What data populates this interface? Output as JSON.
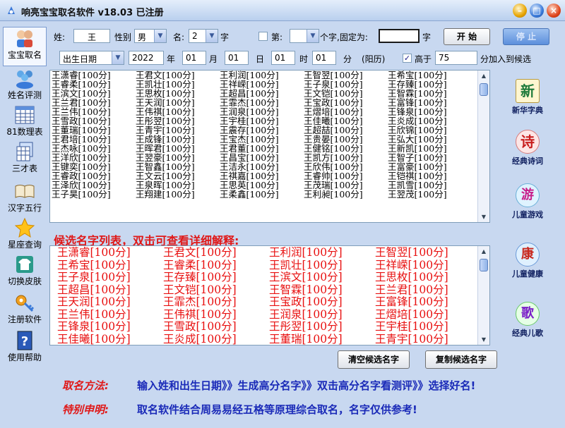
{
  "window": {
    "title": "响亮宝宝取名软件 v18.03  已注册",
    "min_glyph": "–",
    "max_glyph": "□",
    "close_glyph": "×"
  },
  "sidebar": {
    "items": [
      {
        "label": "宝宝取名",
        "icon": "baby-icon"
      },
      {
        "label": "姓名评测",
        "icon": "people-icon"
      },
      {
        "label": "81数理表",
        "icon": "table-icon"
      },
      {
        "label": "三才表",
        "icon": "sheets-icon"
      },
      {
        "label": "汉字五行",
        "icon": "book-icon"
      },
      {
        "label": "星座查询",
        "icon": "star-icon"
      },
      {
        "label": "切换皮肤",
        "icon": "shirt-icon"
      },
      {
        "label": "注册软件",
        "icon": "key-icon"
      },
      {
        "label": "使用帮助",
        "icon": "help-icon"
      }
    ]
  },
  "form": {
    "surname_label": "姓:",
    "surname_value": "王",
    "gender_label": "性别",
    "gender_value": "男",
    "name_label": "名:",
    "name_length": "2",
    "name_unit": "字",
    "fixed_pos_label": "第:",
    "fixed_pos_mid": "个字,固定为:",
    "fixed_pos_unit": "字",
    "date_type": "出生日期",
    "year": "2022",
    "year_unit": "年",
    "month": "01",
    "month_unit": "月",
    "day": "01",
    "day_unit": "日",
    "hour": "01",
    "hour_unit": "时",
    "minute": "01",
    "minute_unit": "分",
    "calendar": "(阳历)",
    "higher_label": "高于",
    "higher_value": "75",
    "higher_suffix": "分加入到候选",
    "higher_checked": "✓",
    "start_button": "开  始",
    "stop_button": "停  止"
  },
  "score_list": [
    [
      "王潇睿[100分]",
      "王君文[100分]",
      "王利润[100分]",
      "王智翌[100分]",
      "王希宝[100分]"
    ],
    [
      "王睿柔[100分]",
      "王凯壮[100分]",
      "王祥嵘[100分]",
      "王子泉[100分]",
      "王存臻[100分]"
    ],
    [
      "王滨文[100分]",
      "王思枚[100分]",
      "王超昌[100分]",
      "王文铠[100分]",
      "王智霖[100分]"
    ],
    [
      "王兰君[100分]",
      "王天润[100分]",
      "王霏杰[100分]",
      "王宝政[100分]",
      "王富锋[100分]"
    ],
    [
      "王兰伟[100分]",
      "王伟祺[100分]",
      "王润泉[100分]",
      "王熠培[100分]",
      "王锋泉[100分]"
    ],
    [
      "王雪政[100分]",
      "王彤翌[100分]",
      "王宇桂[100分]",
      "王佳曦[100分]",
      "王炎成[100分]"
    ],
    [
      "王董瑞[100分]",
      "王青宇[100分]",
      "王震存[100分]",
      "王超喆[100分]",
      "王欣锦[100分]"
    ],
    [
      "王君培[100分]",
      "王成锋[100分]",
      "王宝杰[100分]",
      "王贵晏[100分]",
      "王弘大[100分]"
    ],
    [
      "王杰咏[100分]",
      "王晖君[100分]",
      "王君董[100分]",
      "王健铭[100分]",
      "王新凯[100分]"
    ],
    [
      "王洋欣[100分]",
      "王翌豪[100分]",
      "王昌宝[100分]",
      "王凯方[100分]",
      "王智子[100分]"
    ],
    [
      "王键奕[100分]",
      "王智鑫[100分]",
      "王洁永[100分]",
      "王欣伟[100分]",
      "王富豪[100分]"
    ],
    [
      "王睿政[100分]",
      "王文云[100分]",
      "王祺嘉[100分]",
      "王睿帅[100分]",
      "王铠祺[100分]"
    ],
    [
      "王泽欣[100分]",
      "王泉晖[100分]",
      "王思英[100分]",
      "王茂瑞[100分]",
      "王凯雪[100分]"
    ],
    [
      "王子昊[100分]",
      "王翔建[100分]",
      "王柔鑫[100分]",
      "王利昶[100分]",
      "王翌茂[100分]"
    ]
  ],
  "candidate_title": "候选名字列表，双击可查看详细解释:",
  "candidates": [
    [
      "王潇睿[100分]",
      "王君文[100分]",
      "王利润[100分]",
      "王智翌[100分]"
    ],
    [
      "王希宝[100分]",
      "王睿柔[100分]",
      "王凯壮[100分]",
      "王祥嵘[100分]"
    ],
    [
      "王子泉[100分]",
      "王存臻[100分]",
      "王滨文[100分]",
      "王思枚[100分]"
    ],
    [
      "王超昌[100分]",
      "王文铠[100分]",
      "王智霖[100分]",
      "王兰君[100分]"
    ],
    [
      "王天润[100分]",
      "王霏杰[100分]",
      "王宝政[100分]",
      "王富锋[100分]"
    ],
    [
      "王兰伟[100分]",
      "王伟祺[100分]",
      "王润泉[100分]",
      "王熠培[100分]"
    ],
    [
      "王锋泉[100分]",
      "王雪政[100分]",
      "王彤翌[100分]",
      "王宇桂[100分]"
    ],
    [
      "王佳曦[100分]",
      "王炎成[100分]",
      "王董瑞[100分]",
      "王青宇[100分]"
    ]
  ],
  "buttons": {
    "clear": "清空候选名字",
    "copy": "复制候选名字"
  },
  "right_panel": [
    {
      "label": "新华字典",
      "glyph": "新",
      "color": "#1e7a3a",
      "icon": "dictionary-icon"
    },
    {
      "label": "经典诗词",
      "glyph": "诗",
      "color": "#c81e1e",
      "icon": "poetry-icon"
    },
    {
      "label": "儿童游戏",
      "glyph": "游",
      "color": "#c81e8a",
      "icon": "game-icon"
    },
    {
      "label": "儿童健康",
      "glyph": "康",
      "color": "#c8281e",
      "icon": "health-icon"
    },
    {
      "label": "经典儿歌",
      "glyph": "歌",
      "color": "#7a1ec8",
      "icon": "song-icon"
    }
  ],
  "footer": {
    "method_label": "取名方法:",
    "method_text": "输入姓和出生日期》》生成高分名字》》双击高分名字看测评》》选择好名!",
    "notice_label": "特别申明:",
    "notice_text": "取名软件结合周易易经五格等原理综合取名，名字仅供参考!"
  }
}
